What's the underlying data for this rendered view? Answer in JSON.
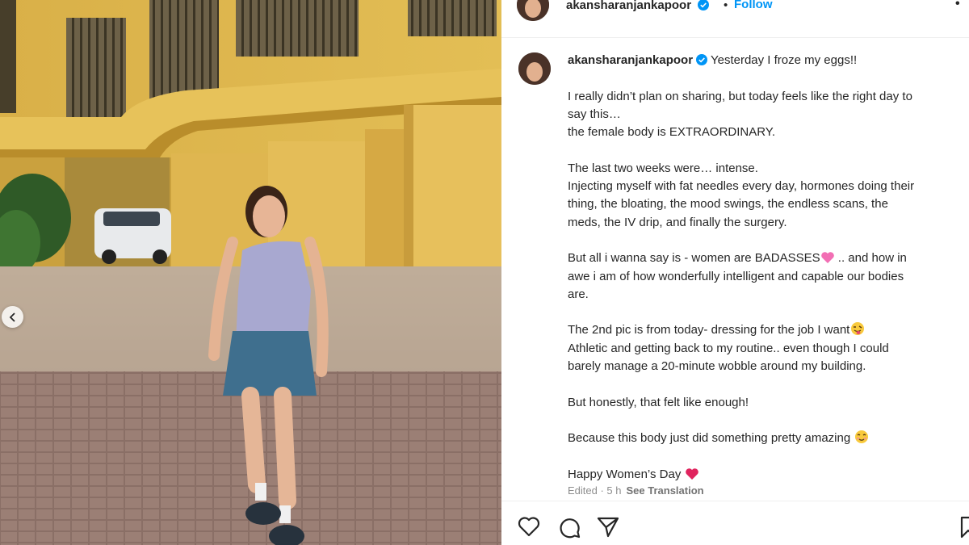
{
  "header": {
    "username": "akansharanjankapoor",
    "separator": "•",
    "follow_label": "Follow",
    "more_label": "•"
  },
  "post": {
    "username": "akansharanjankapoor",
    "caption_first": "Yesterday I froze my eggs!!",
    "lines": [
      "I really didn’t plan on sharing, but today feels like the right day to",
      "say this…",
      "the female body is EXTRAORDINARY.",
      "The last two weeks were… intense.",
      "Injecting myself with fat needles every day, hormones doing their",
      "thing, the bloating, the mood swings, the endless scans, the",
      "meds, the IV drip, and finally the surgery.",
      "But all i wanna say is - women are BADASSES",
      " .. and how in",
      "awe i am of how wonderfully intelligent and capable our bodies",
      "are.",
      "The 2nd pic is from today- dressing for the job I want",
      "Athletic and getting back to my routine.. even though I could",
      "barely manage a 20-minute wobble around my building.",
      "But honestly, that felt like enough!",
      "Because this body just did something pretty amazing ",
      "Happy Women’s Day "
    ],
    "edited": "Edited · 5 h",
    "see_translation": "See Translation"
  },
  "icons": {
    "verified": "verified-badge-icon",
    "heart_emoji": "pink-heart-emoji",
    "tongue_emoji": "winking-tongue-emoji",
    "smile_emoji": "smiling-face-emoji",
    "red_heart_emoji": "red-heart-emoji",
    "like": "heart-outline-icon",
    "comment": "comment-bubble-icon",
    "share": "paper-plane-icon",
    "save": "bookmark-icon",
    "prev": "chevron-left-icon"
  },
  "colors": {
    "link_blue": "#0095f6",
    "verified_blue": "#0095f6",
    "text": "#262626",
    "muted": "#8e8e8e"
  }
}
